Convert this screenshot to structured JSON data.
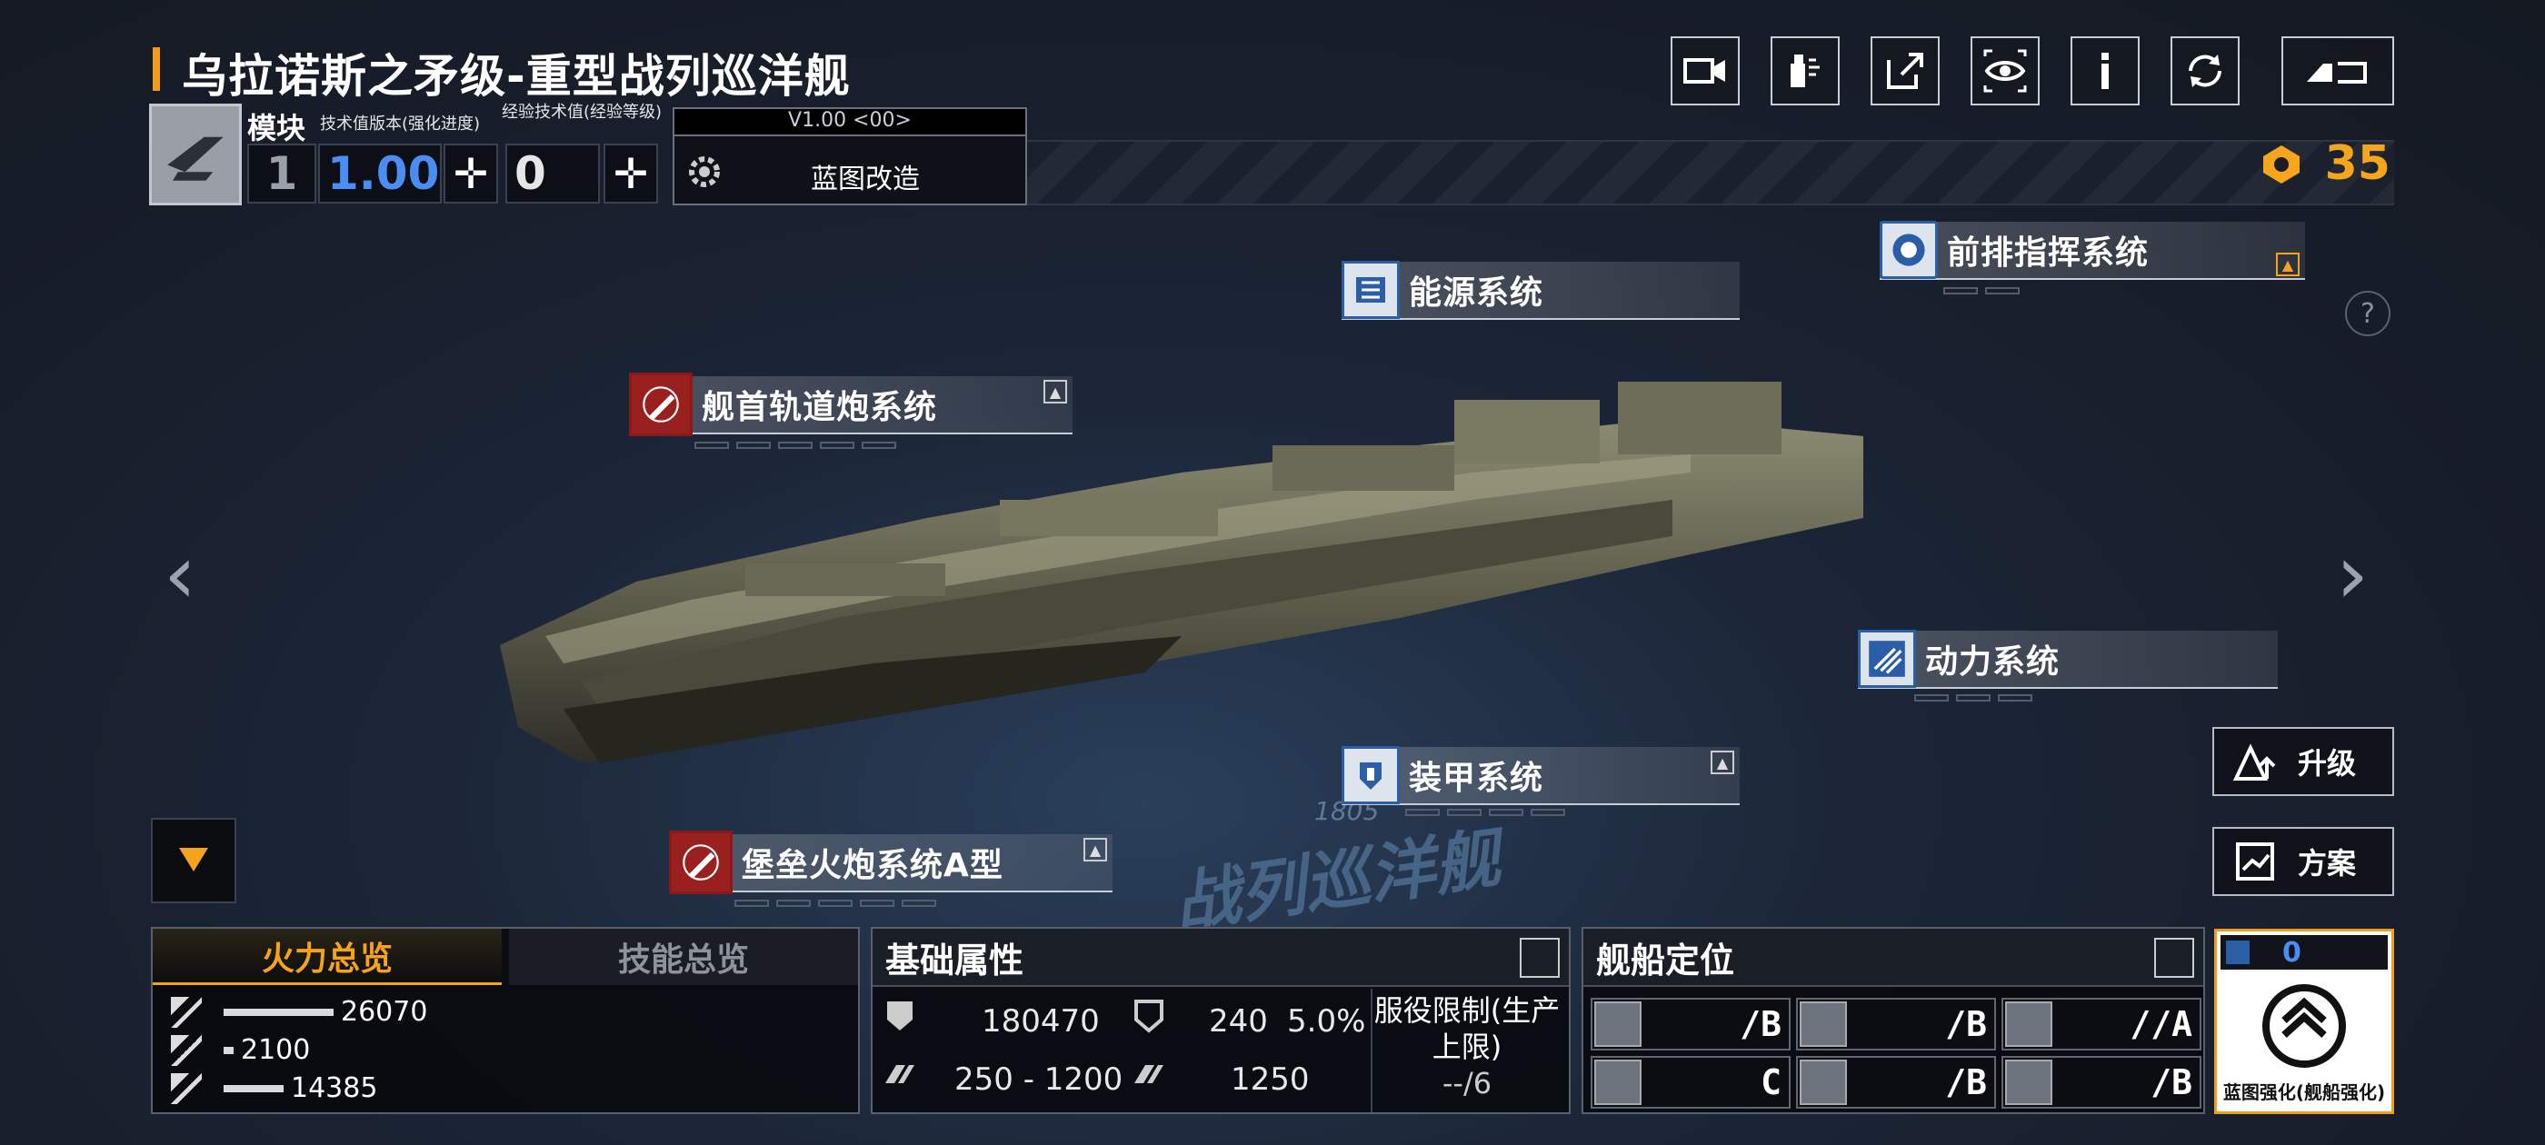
{
  "title": "乌拉诺斯之矛级-重型战列巡洋舰",
  "colors": {
    "accent": "#f29c1f",
    "blue": "#2a5fa8",
    "red": "#9a2020"
  },
  "top_buttons": [
    {
      "name": "camera-icon"
    },
    {
      "name": "paint-spray-icon"
    },
    {
      "name": "share-icon"
    },
    {
      "name": "view-eye-icon"
    },
    {
      "name": "info-icon"
    },
    {
      "name": "refresh-icon"
    },
    {
      "name": "back-icon"
    }
  ],
  "module": {
    "label": "模块",
    "tech_label": "技术值版本(强化进度)",
    "exp_label": "经验技术值(经验等级)",
    "index": "1",
    "tech_value": "1.00",
    "exp_value": "0"
  },
  "blueprint": {
    "version": "V1.00 <00>",
    "label": "蓝图改造"
  },
  "currency": {
    "value": "35"
  },
  "systems": {
    "energy": "能源系统",
    "forward_command": "前排指挥系统",
    "bow_railgun": "舰首轨道炮系统",
    "power": "动力系统",
    "armor": "装甲系统",
    "fortress_cannon": "堡垒火炮系统A型"
  },
  "ship_marks": {
    "hull_no": "1805",
    "class_text": "战列巡洋舰"
  },
  "side_buttons": {
    "upgrade": "升级",
    "plan": "方案"
  },
  "nav": {
    "prev": "‹",
    "next": "›"
  },
  "fire_panel": {
    "tab_active": "火力总览",
    "tab_inactive": "技能总览",
    "rows": [
      {
        "value": "26070",
        "fraction": 0.55
      },
      {
        "value": "2100",
        "fraction": 0.05
      },
      {
        "value": "14385",
        "fraction": 0.3
      }
    ]
  },
  "base_attrs": {
    "title": "基础属性",
    "hp": "180470",
    "armor": "240",
    "armor_pct": "5.0%",
    "speed": "250 - 1200",
    "warp": "1250",
    "service_limit_label": "服役限制(生产上限)",
    "service_limit_value": "--/6"
  },
  "positioning": {
    "title": "舰船定位",
    "grades": [
      "/B",
      "/B",
      "//A",
      "C",
      "/B",
      "/B"
    ]
  },
  "enhance": {
    "count": "0",
    "label": "蓝图强化(舰船强化)"
  }
}
